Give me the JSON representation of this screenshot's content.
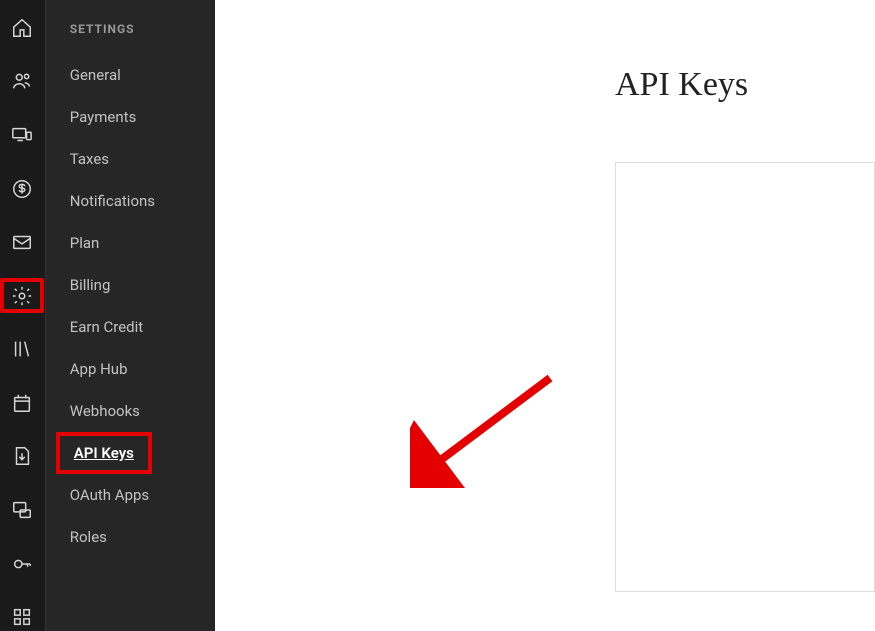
{
  "sidepanel": {
    "section_label": "SETTINGS",
    "items": [
      {
        "label": "General"
      },
      {
        "label": "Payments"
      },
      {
        "label": "Taxes"
      },
      {
        "label": "Notifications"
      },
      {
        "label": "Plan"
      },
      {
        "label": "Billing"
      },
      {
        "label": "Earn Credit"
      },
      {
        "label": "App Hub"
      },
      {
        "label": "Webhooks"
      },
      {
        "label": "API Keys"
      },
      {
        "label": "OAuth Apps"
      },
      {
        "label": "Roles"
      }
    ]
  },
  "main": {
    "page_title": "API Keys"
  }
}
